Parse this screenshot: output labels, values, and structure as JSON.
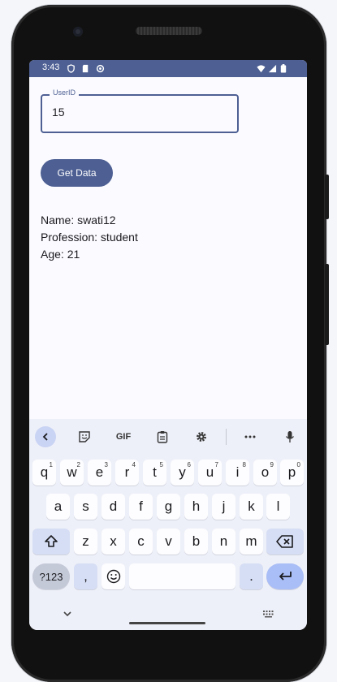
{
  "status_bar": {
    "time": "3:43",
    "icons": [
      "shield-icon",
      "sd-card-icon",
      "sync-icon",
      "wifi-icon",
      "signal-icon",
      "battery-icon"
    ]
  },
  "form": {
    "userid_label": "UserID",
    "userid_value": "15"
  },
  "button": {
    "get_data_label": "Get Data"
  },
  "result": {
    "name": "Name: swati12",
    "profession": "Profession: student",
    "age": "Age: 21"
  },
  "keyboard": {
    "toolbar": [
      "back-icon",
      "sticker-icon",
      "GIF",
      "clipboard-icon",
      "settings-icon",
      "more-icon",
      "mic-icon"
    ],
    "row1": [
      {
        "key": "q",
        "hint": "1"
      },
      {
        "key": "w",
        "hint": "2"
      },
      {
        "key": "e",
        "hint": "3"
      },
      {
        "key": "r",
        "hint": "4"
      },
      {
        "key": "t",
        "hint": "5"
      },
      {
        "key": "y",
        "hint": "6"
      },
      {
        "key": "u",
        "hint": "7"
      },
      {
        "key": "i",
        "hint": "8"
      },
      {
        "key": "o",
        "hint": "9"
      },
      {
        "key": "p",
        "hint": "0"
      }
    ],
    "row2": [
      "a",
      "s",
      "d",
      "f",
      "g",
      "h",
      "j",
      "k",
      "l"
    ],
    "row3": [
      "z",
      "x",
      "c",
      "v",
      "b",
      "n",
      "m"
    ],
    "symbols_label": "?123",
    "comma": ",",
    "period": "."
  },
  "colors": {
    "primary": "#4d5f93",
    "screen_bg": "#fbfbff",
    "keyboard_bg": "#eef0f9",
    "func_key": "#d6def5",
    "enter_key": "#a9bdf6"
  }
}
